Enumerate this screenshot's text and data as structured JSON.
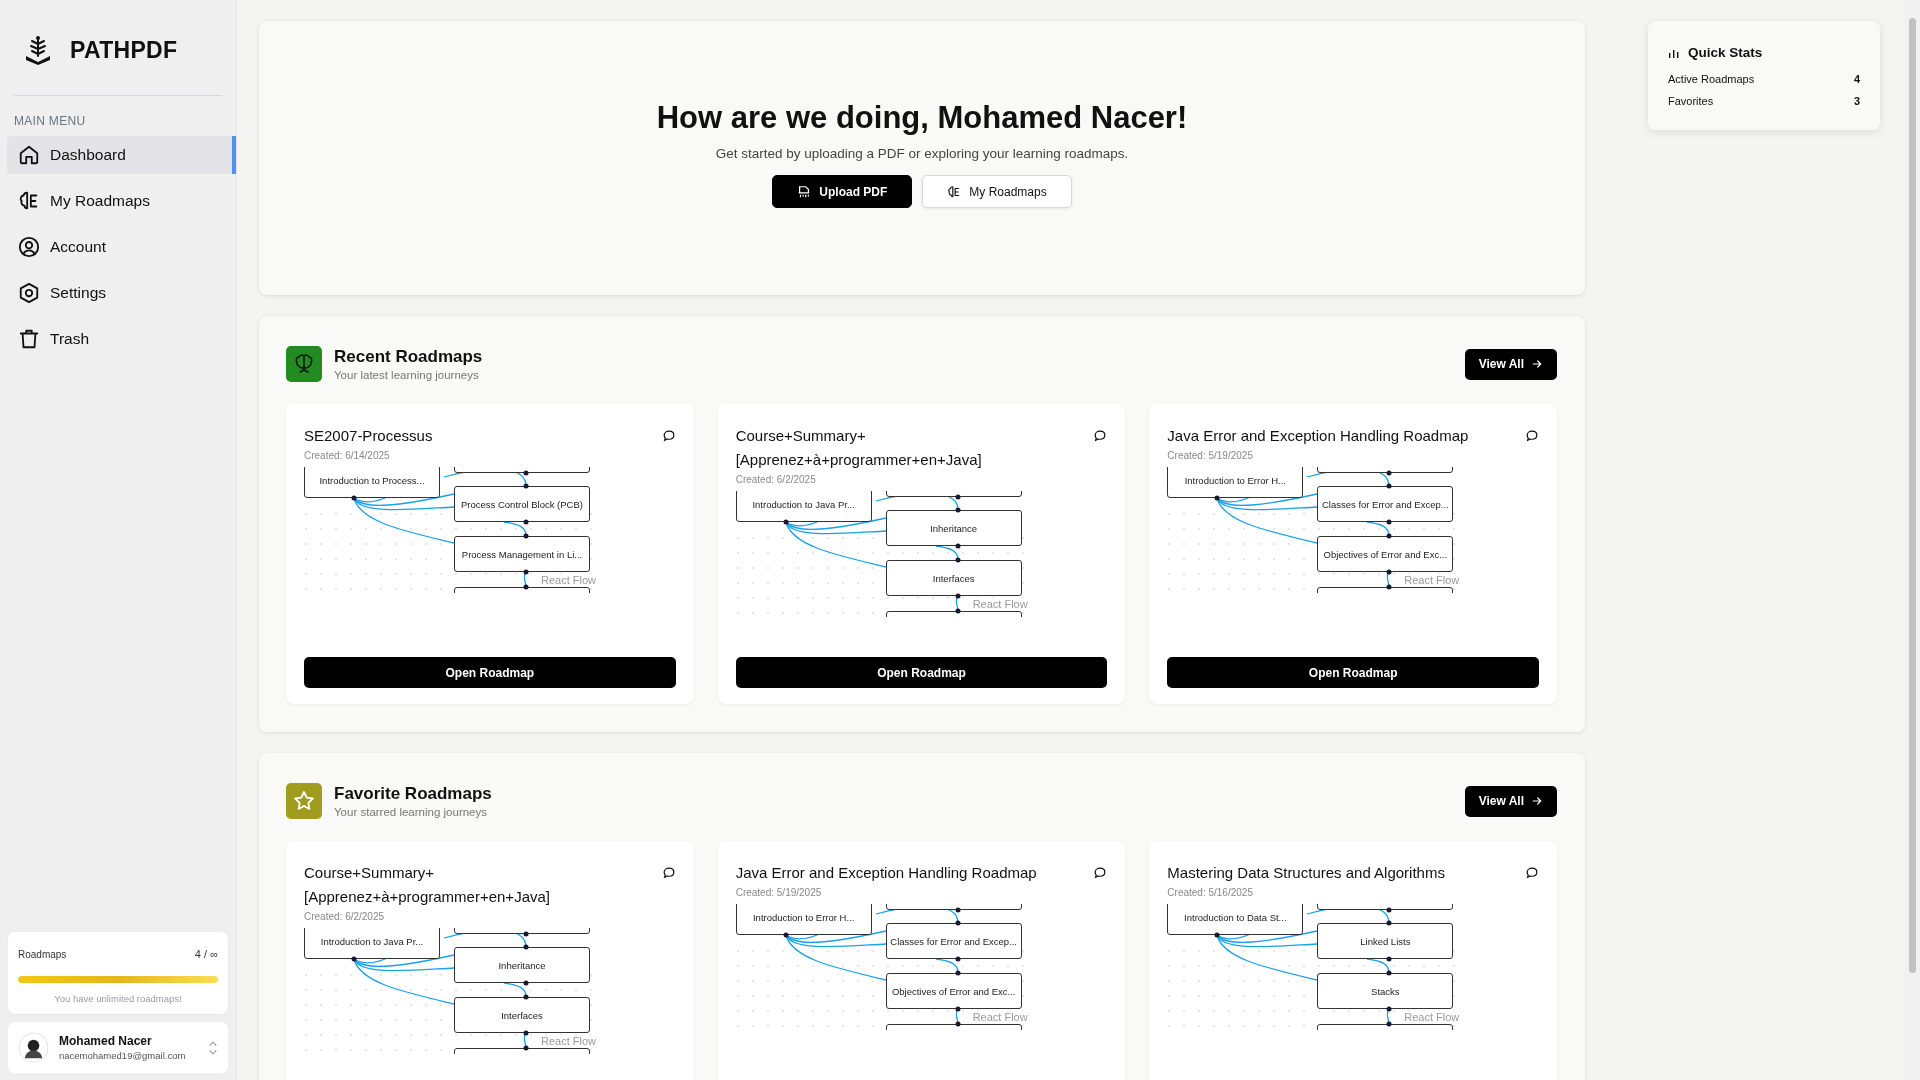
{
  "sidebar": {
    "brand": "PATHPDF",
    "menu_heading": "MAIN MENU",
    "items": [
      {
        "label": "Dashboard",
        "kind": "home",
        "selected": true
      },
      {
        "label": "My Roadmaps",
        "kind": "roadmaps",
        "selected": false
      },
      {
        "label": "Account",
        "kind": "account",
        "selected": false
      },
      {
        "label": "Settings",
        "kind": "settings",
        "selected": false
      },
      {
        "label": "Trash",
        "kind": "trash",
        "selected": false
      }
    ],
    "usage": {
      "label": "Roadmaps",
      "count": "4 / ∞",
      "level": 1,
      "note": "You have unlimited roadmaps!"
    },
    "user": {
      "name": "Mohamed Nacer",
      "email": "nacemohamed19@gmail.com"
    }
  },
  "hero": {
    "title": "How are we doing, Mohamed Nacer!",
    "subtitle": "Get started by uploading a PDF or exploring your learning roadmaps.",
    "buttons": [
      {
        "label": "Upload PDF",
        "kind": "primary"
      },
      {
        "label": "My Roadmaps",
        "kind": "secondary"
      }
    ]
  },
  "sections": [
    {
      "kind": "recent",
      "color": "#228b22",
      "title": "Recent Roadmaps",
      "subtitle": "Your latest learning journeys",
      "action": "View All",
      "cards": [
        {
          "title": "SE2007-Processus",
          "created": "Created: 6/14/2025",
          "start_node": "Introduction to Process...",
          "nodes": [
            "Process Control Block (PCB)",
            "Process Management in Li..."
          ],
          "attribution": "React Flow",
          "button": "Open Roadmap"
        },
        {
          "title": "Course+Summary+[Apprenez+à+programmer+en+Java]",
          "created": "Created: 6/2/2025",
          "start_node": "Introduction to Java Pr...",
          "nodes": [
            "Inheritance",
            "Interfaces"
          ],
          "attribution": "React Flow",
          "button": "Open Roadmap"
        },
        {
          "title": "Java Error and Exception Handling Roadmap",
          "created": "Created: 5/19/2025",
          "start_node": "Introduction to Error H...",
          "nodes": [
            "Classes for Error and Excep...",
            "Objectives of Error and Exc..."
          ],
          "attribution": "React Flow",
          "button": "Open Roadmap"
        }
      ]
    },
    {
      "kind": "favorite",
      "color": "#a09c1e",
      "title": "Favorite Roadmaps",
      "subtitle": "Your starred learning journeys",
      "action": "View All",
      "cards": [
        {
          "title": "Course+Summary+[Apprenez+à+programmer+en+Java]",
          "created": "Created: 6/2/2025",
          "start_node": "Introduction to Java Pr...",
          "nodes": [
            "Inheritance",
            "Interfaces"
          ],
          "attribution": "React Flow"
        },
        {
          "title": "Java Error and Exception Handling Roadmap",
          "created": "Created: 5/19/2025",
          "start_node": "Introduction to Error H...",
          "nodes": [
            "Classes for Error and Excep...",
            "Objectives of Error and Exc..."
          ],
          "attribution": "React Flow"
        },
        {
          "title": "Mastering Data Structures and Algorithms",
          "created": "Created: 5/16/2025",
          "start_node": "Introduction to Data St...",
          "nodes": [
            "Linked Lists",
            "Stacks"
          ],
          "attribution": "React Flow"
        }
      ]
    }
  ],
  "quick_stats": {
    "title": "Quick Stats",
    "rows": [
      {
        "label": "Active Roadmaps",
        "value": "4"
      },
      {
        "label": "Favorites",
        "value": "3"
      }
    ]
  }
}
